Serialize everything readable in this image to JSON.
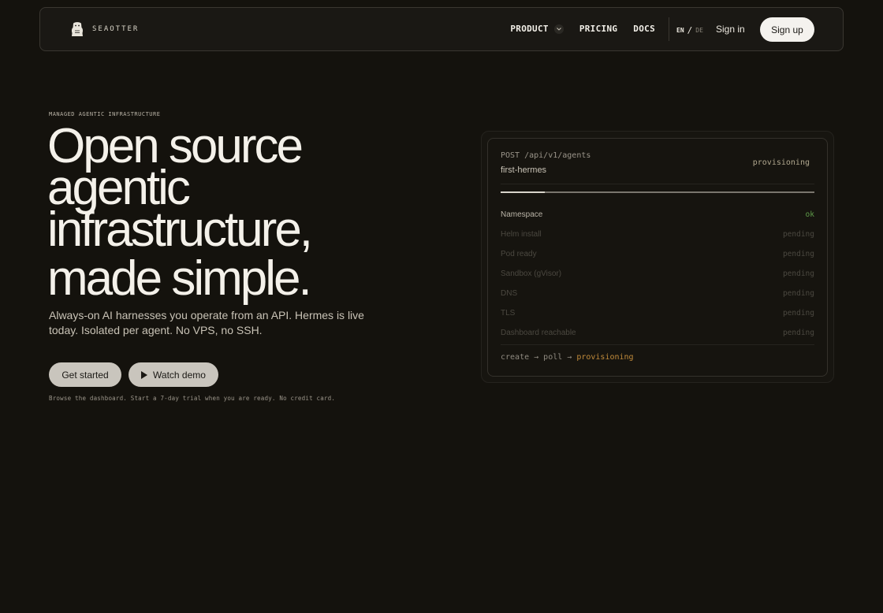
{
  "nav": {
    "brand": "SEAOTTER",
    "links": [
      {
        "label": "PRODUCT",
        "has_dropdown": true
      },
      {
        "label": "PRICING"
      },
      {
        "label": "DOCS"
      }
    ],
    "lang": {
      "active": "EN",
      "separator": "/",
      "other": "DE"
    },
    "signin": "Sign in",
    "signup": "Sign up"
  },
  "hero": {
    "eyebrow": "MANAGED AGENTIC INFRASTRUCTURE",
    "headline": [
      "Open source",
      "agentic",
      "infrastructure,",
      "made simple."
    ],
    "subtitle": "Always-on AI harnesses you operate from an API. Hermes is live today. Isolated per agent. No VPS, no SSH.",
    "cta_primary": "Get started",
    "cta_secondary": "Watch demo",
    "note": "Browse the dashboard. Start a 7-day trial when you are ready. No credit card."
  },
  "card": {
    "request": "POST /api/v1/agents",
    "agent_name": "first-hermes",
    "status": "provisioning",
    "progress": 0.14,
    "steps": [
      {
        "name": "Namespace",
        "state": "ok"
      },
      {
        "name": "Helm install",
        "state": "pending"
      },
      {
        "name": "Pod ready",
        "state": "pending"
      },
      {
        "name": "Sandbox (gVisor)",
        "state": "pending"
      },
      {
        "name": "DNS",
        "state": "pending"
      },
      {
        "name": "TLS",
        "state": "pending"
      },
      {
        "name": "Dashboard reachable",
        "state": "pending"
      }
    ],
    "flow": {
      "prefix": "create → poll → ",
      "current": "provisioning"
    }
  },
  "colors": {
    "background": "#14120d",
    "ok": "#5f9c4a",
    "accent": "#c08a3a"
  },
  "icons": [
    "otter-logo-icon",
    "chevron-down-icon",
    "play-icon"
  ]
}
